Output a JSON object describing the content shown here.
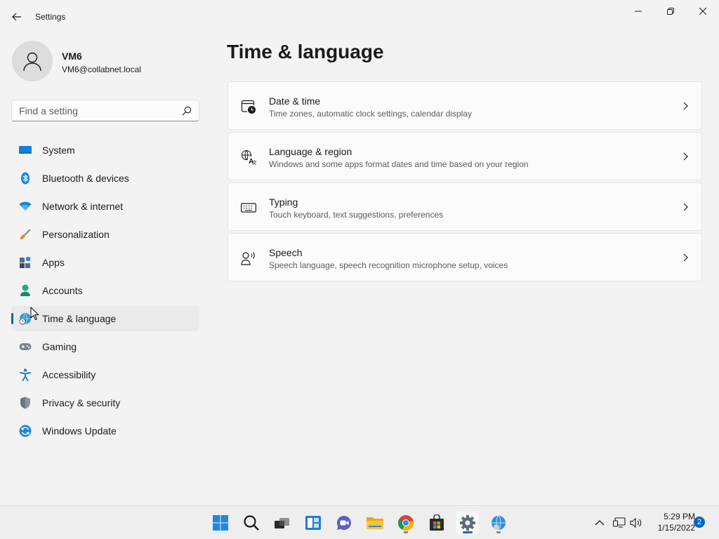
{
  "window": {
    "title": "Settings"
  },
  "profile": {
    "name": "VM6",
    "email": "VM6@collabnet.local"
  },
  "search": {
    "placeholder": "Find a setting"
  },
  "sidebar": {
    "items": [
      {
        "label": "System",
        "icon": "system-icon"
      },
      {
        "label": "Bluetooth & devices",
        "icon": "bluetooth-icon"
      },
      {
        "label": "Network & internet",
        "icon": "wifi-icon"
      },
      {
        "label": "Personalization",
        "icon": "brush-icon"
      },
      {
        "label": "Apps",
        "icon": "apps-icon"
      },
      {
        "label": "Accounts",
        "icon": "person-icon"
      },
      {
        "label": "Time & language",
        "icon": "globe-clock-icon",
        "active": true
      },
      {
        "label": "Gaming",
        "icon": "gamepad-icon"
      },
      {
        "label": "Accessibility",
        "icon": "accessibility-icon"
      },
      {
        "label": "Privacy & security",
        "icon": "shield-icon"
      },
      {
        "label": "Windows Update",
        "icon": "update-icon"
      }
    ]
  },
  "main": {
    "title": "Time & language",
    "cards": [
      {
        "title": "Date & time",
        "description": "Time zones, automatic clock settings, calendar display",
        "icon": "calendar-clock-icon"
      },
      {
        "title": "Language & region",
        "description": "Windows and some apps format dates and time based on your region",
        "icon": "language-icon"
      },
      {
        "title": "Typing",
        "description": "Touch keyboard, text suggestions, preferences",
        "icon": "keyboard-icon"
      },
      {
        "title": "Speech",
        "description": "Speech language, speech recognition microphone setup, voices",
        "icon": "speech-icon"
      }
    ]
  },
  "taskbar": {
    "apps": [
      "start-icon",
      "search-icon",
      "task-view-icon",
      "widgets-icon",
      "chat-icon",
      "file-explorer-icon",
      "chrome-icon",
      "store-icon",
      "settings-icon",
      "edge-icon"
    ],
    "active_app": "settings-icon",
    "time": "5:29 PM",
    "date": "1/15/2022",
    "notification_count": "2"
  },
  "colors": {
    "accent": "#0067c0",
    "background": "#f3f3f3",
    "card": "#fbfbfb"
  }
}
